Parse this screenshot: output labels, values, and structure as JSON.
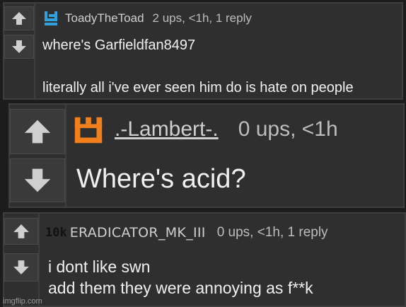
{
  "comments": [
    {
      "username": "ToadyTheToad",
      "stats": "2 ups, <1h, 1 reply",
      "lines": [
        "where's Garfieldfan8497",
        "",
        "literally all i've ever seen him do is hate on people"
      ],
      "avatar_color": "#2ea3e0",
      "badge": ""
    },
    {
      "username": ".-Lambert-.",
      "stats": "0 ups, <1h",
      "lines": [
        "Where's acid?"
      ],
      "avatar_color": "#f07f1c",
      "badge": ""
    },
    {
      "username": "ERADICATOR_MK_III",
      "stats": "0 ups, <1h, 1 reply",
      "lines": [
        "i dont like swn",
        "add them they were annoying as f**k"
      ],
      "avatar_color": "#111111",
      "badge": "10k"
    }
  ],
  "watermark": "imgflip.com",
  "colors": {
    "background": "#1c1c1c",
    "panel": "#2f2f2f",
    "border": "#3e3e3e",
    "text": "#f0f0f0",
    "meta_text": "#bdbdbd"
  }
}
